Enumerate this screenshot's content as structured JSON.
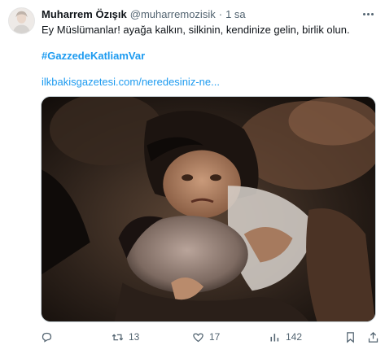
{
  "author": {
    "name": "Muharrem Özışık",
    "handle": "@muharremozisik",
    "separator": "·",
    "time": "1 sa"
  },
  "tweet": {
    "text": "Ey Müslümanlar! ayağa kalkın, silkinin, kendinize gelin, birlik olun.",
    "hashtag": "#GazzedeKatliamVar",
    "link": "ilkbakisgazetesi.com/neredesiniz-ne..."
  },
  "actions": {
    "replies": "",
    "retweets": "13",
    "likes": "17",
    "views": "142"
  },
  "colors": {
    "accent": "#1d9bf0",
    "secondary_text": "#536471",
    "text": "#0f1419"
  },
  "icons": [
    "more-icon",
    "reply-icon",
    "retweet-icon",
    "like-icon",
    "views-icon",
    "bookmark-icon",
    "share-icon"
  ]
}
